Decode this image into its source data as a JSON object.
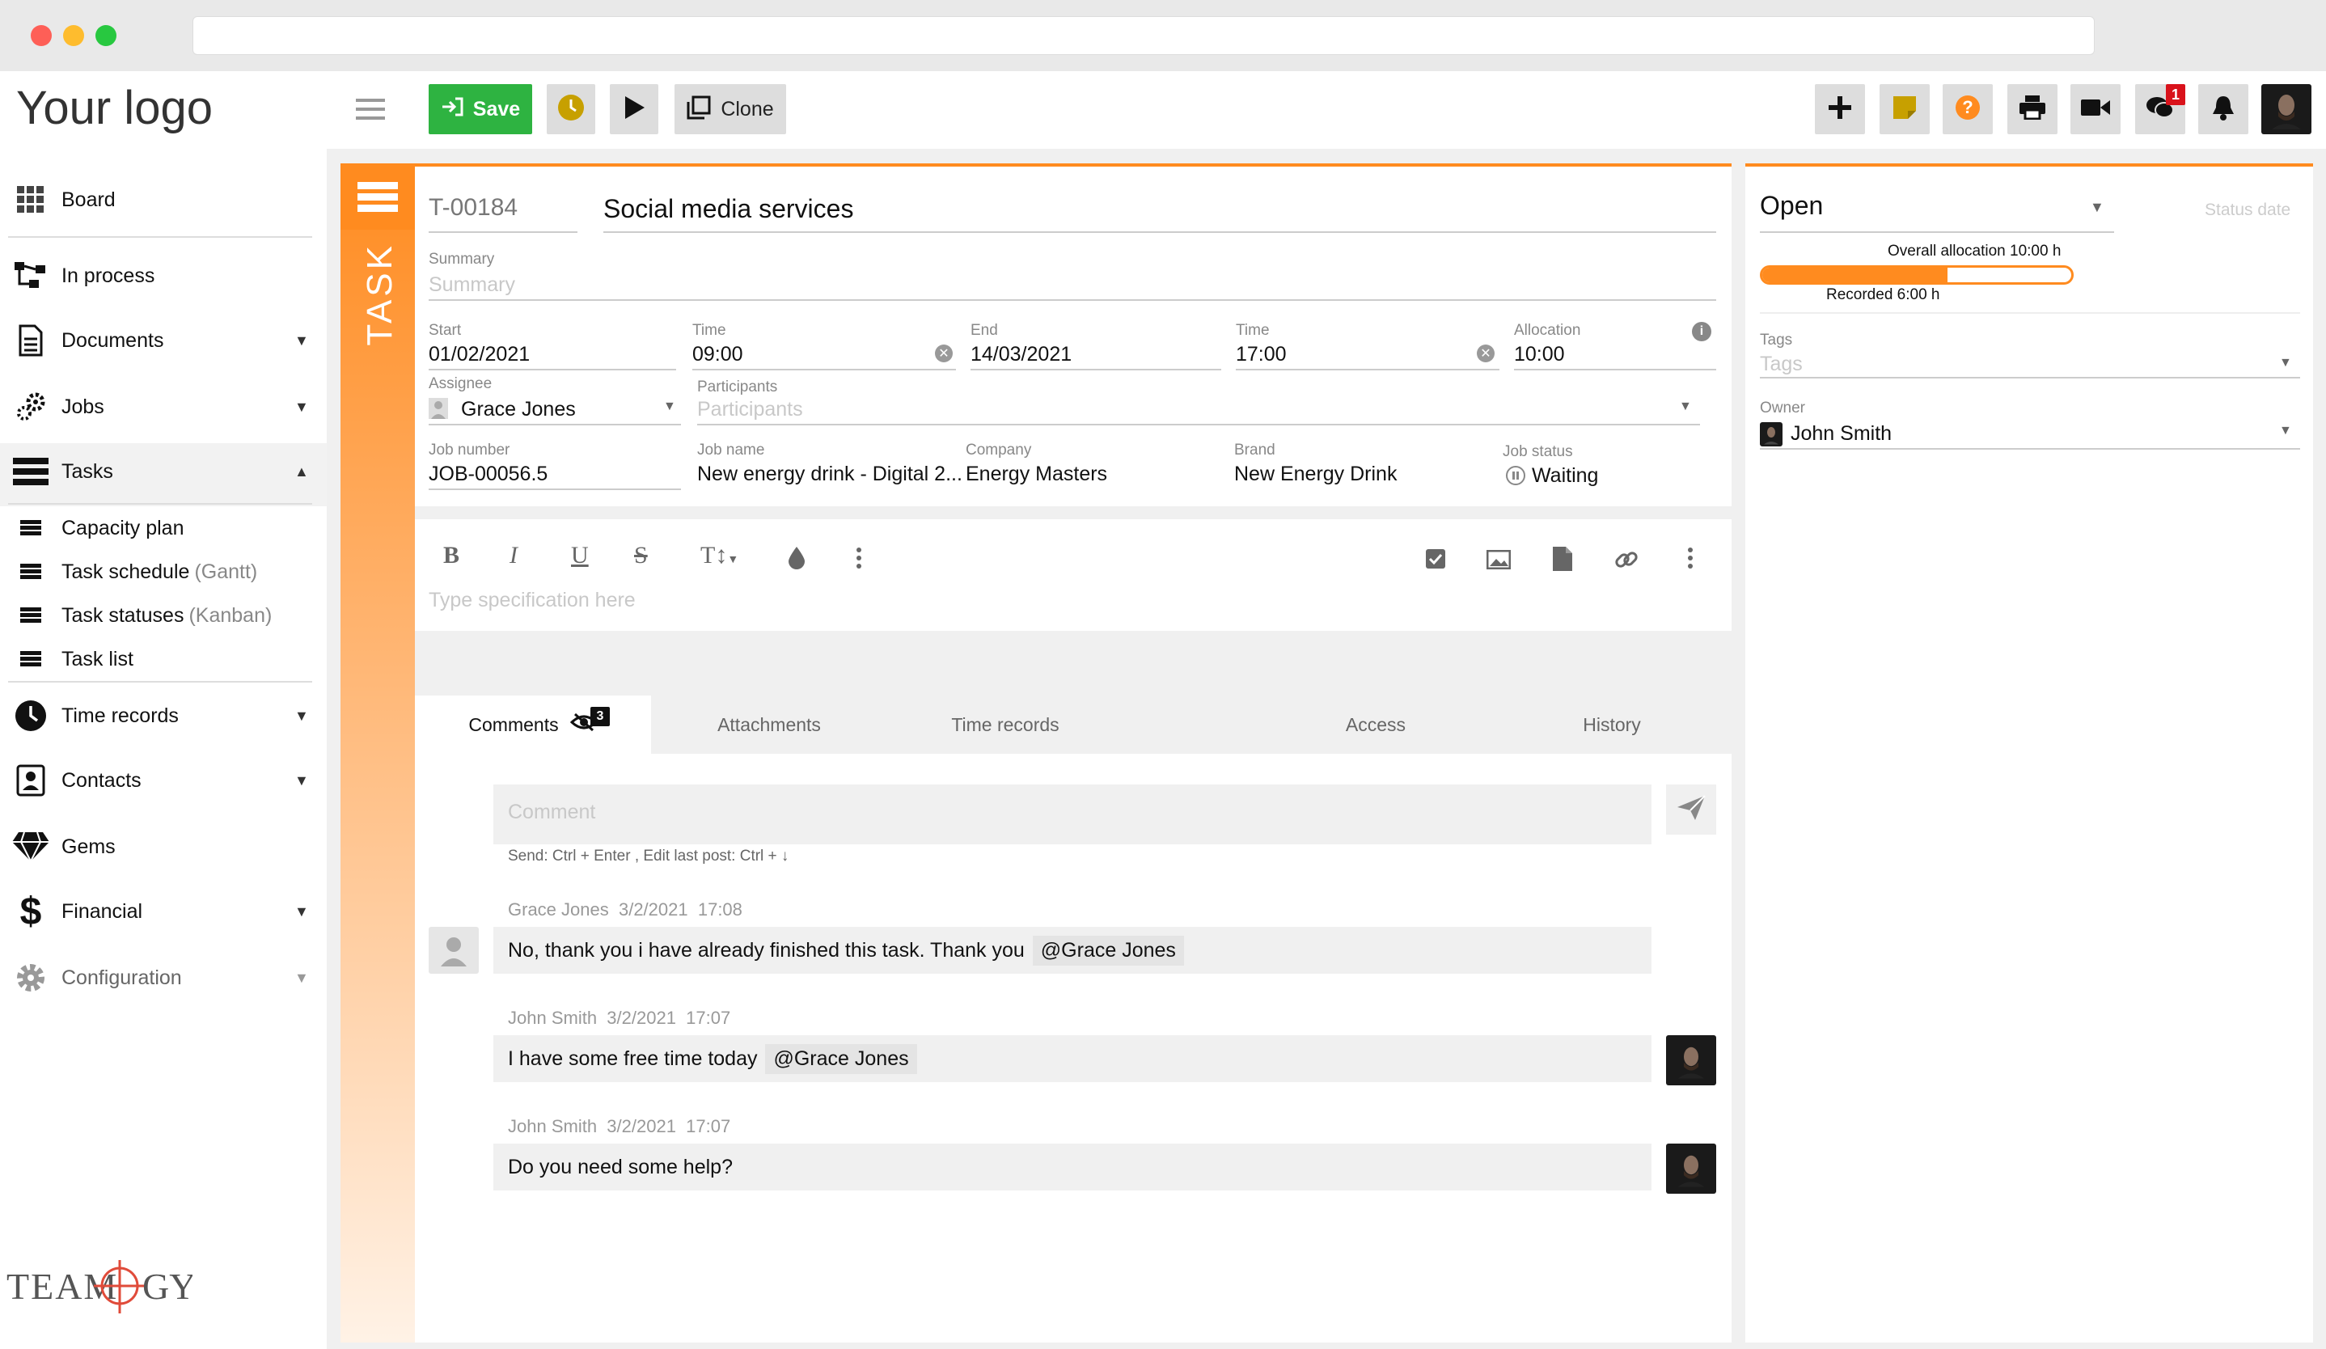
{
  "app": {
    "logo_text": "Your logo",
    "brand_footer": "TEAMOGY",
    "accent": "#ff8b1f",
    "save_green": "#2eb341"
  },
  "sidebar": {
    "items": [
      {
        "label": "Board",
        "icon": "grid-icon"
      },
      {
        "label": "In process",
        "icon": "workflow-icon"
      },
      {
        "label": "Documents",
        "icon": "document-icon"
      },
      {
        "label": "Jobs",
        "icon": "gears-icon"
      },
      {
        "label": "Tasks",
        "icon": "tasks-icon"
      },
      {
        "label": "Time records",
        "icon": "clock-icon"
      },
      {
        "label": "Contacts",
        "icon": "contact-icon"
      },
      {
        "label": "Gems",
        "icon": "gem-icon"
      },
      {
        "label": "Financial",
        "icon": "dollar-icon"
      },
      {
        "label": "Configuration",
        "icon": "cog-icon"
      }
    ],
    "task_subitems": [
      {
        "label": "Capacity plan",
        "hint": ""
      },
      {
        "label": "Task schedule",
        "hint": "(Gantt)"
      },
      {
        "label": "Task statuses",
        "hint": "(Kanban)"
      },
      {
        "label": "Task list",
        "hint": ""
      }
    ]
  },
  "toolbar": {
    "save_label": "Save",
    "clone_label": "Clone",
    "chat_badge": "1"
  },
  "task": {
    "side_label": "TASK",
    "id": "T-00184",
    "title": "Social media services",
    "summary_label": "Summary",
    "summary_placeholder": "Summary",
    "start_label": "Start",
    "start_value": "01/02/2021",
    "start_time_label": "Time",
    "start_time_value": "09:00",
    "end_label": "End",
    "end_value": "14/03/2021",
    "end_time_label": "Time",
    "end_time_value": "17:00",
    "allocation_label": "Allocation",
    "allocation_value": "10:00",
    "assignee_label": "Assignee",
    "assignee_value": "Grace Jones",
    "participants_label": "Participants",
    "participants_placeholder": "Participants",
    "job_number_label": "Job number",
    "job_number_value": "JOB-00056.5",
    "job_name_label": "Job name",
    "job_name_value": "New energy drink - Digital 2...",
    "company_label": "Company",
    "company_value": "Energy Masters",
    "brand_label": "Brand",
    "brand_value": "New Energy Drink",
    "job_status_label": "Job status",
    "job_status_value": "Waiting",
    "spec_placeholder": "Type specification here"
  },
  "tabs": [
    {
      "label": "Comments",
      "badge": "3"
    },
    {
      "label": "Attachments"
    },
    {
      "label": "Time records"
    },
    {
      "label": "Access"
    },
    {
      "label": "History"
    }
  ],
  "comments": {
    "placeholder": "Comment",
    "hint": "Send: Ctrl + Enter , Edit last post: Ctrl + ↓",
    "items": [
      {
        "author": "Grace Jones",
        "date": "3/2/2021",
        "time": "17:08",
        "text": "No, thank you i have already finished this task. Thank you",
        "mention": "@Grace Jones"
      },
      {
        "author": "John Smith",
        "date": "3/2/2021",
        "time": "17:07",
        "text": "I have some free time today",
        "mention": "@Grace Jones"
      },
      {
        "author": "John Smith",
        "date": "3/2/2021",
        "time": "17:07",
        "text": "Do you need some help?",
        "mention": ""
      }
    ]
  },
  "status_panel": {
    "status": "Open",
    "status_date_label": "Status date",
    "overall_allocation": "Overall allocation 10:00 h",
    "recorded": "Recorded 6:00 h",
    "progress_percent": 60,
    "tags_label": "Tags",
    "tags_placeholder": "Tags",
    "owner_label": "Owner",
    "owner_value": "John Smith"
  }
}
